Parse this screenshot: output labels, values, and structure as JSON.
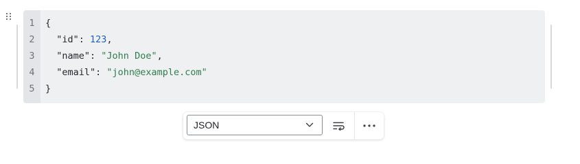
{
  "code_block": {
    "language": "JSON",
    "lines": [
      {
        "number": "1",
        "tokens": [
          {
            "t": "{",
            "k": "punc"
          }
        ]
      },
      {
        "number": "2",
        "tokens": [
          {
            "t": "  \"id\"",
            "k": "key"
          },
          {
            "t": ": ",
            "k": "punc"
          },
          {
            "t": "123",
            "k": "num"
          },
          {
            "t": ",",
            "k": "punc"
          }
        ]
      },
      {
        "number": "3",
        "tokens": [
          {
            "t": "  \"name\"",
            "k": "key"
          },
          {
            "t": ": ",
            "k": "punc"
          },
          {
            "t": "\"John Doe\"",
            "k": "str"
          },
          {
            "t": ",",
            "k": "punc"
          }
        ]
      },
      {
        "number": "4",
        "tokens": [
          {
            "t": "  \"email\"",
            "k": "key"
          },
          {
            "t": ": ",
            "k": "punc"
          },
          {
            "t": "\"john@example.com\"",
            "k": "str"
          }
        ]
      },
      {
        "number": "5",
        "tokens": [
          {
            "t": "}",
            "k": "punc"
          }
        ]
      }
    ]
  },
  "toolbar": {
    "language_value": "JSON",
    "icons": {
      "dropdown": "chevron-down-icon",
      "wrap": "wrap-lines-icon",
      "more": "more-horizontal-icon",
      "drag": "drag-handle-icon"
    }
  },
  "colors": {
    "code_bg": "#eff0f2",
    "gutter_bg": "#e4e5e8",
    "number": "#1f5fbf",
    "string": "#2e7d4f"
  }
}
